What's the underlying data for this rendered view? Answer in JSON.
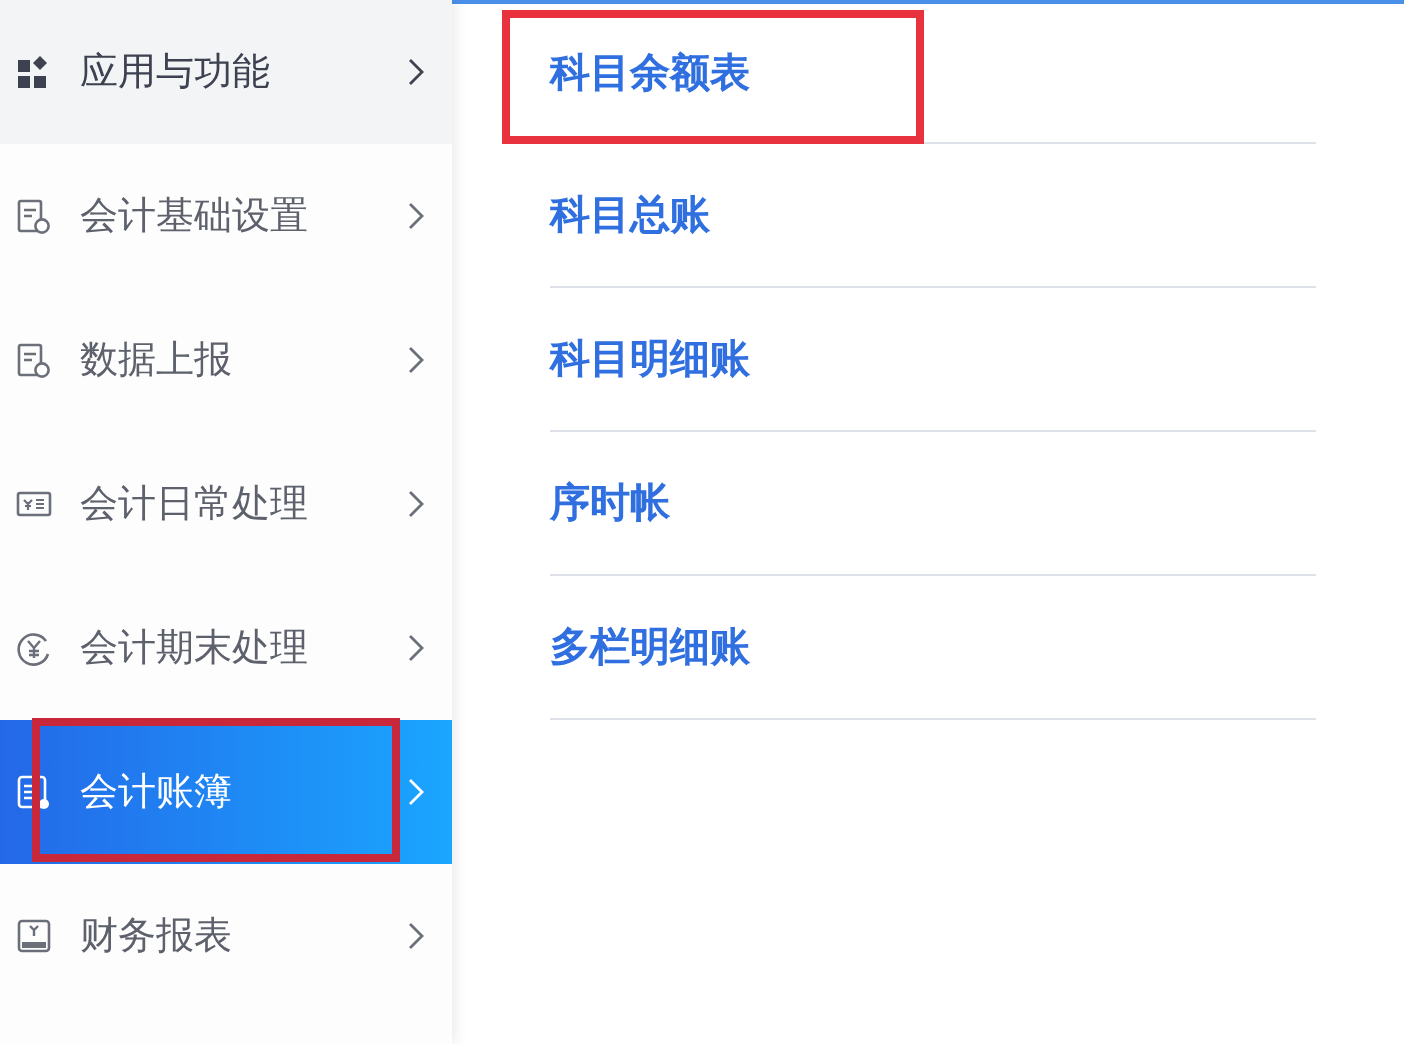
{
  "sidebar": {
    "items": [
      {
        "label": "应用与功能",
        "selected": false,
        "highlighted": true,
        "annotated": false
      },
      {
        "label": "会计基础设置",
        "selected": false,
        "highlighted": false,
        "annotated": false
      },
      {
        "label": "数据上报",
        "selected": false,
        "highlighted": false,
        "annotated": false
      },
      {
        "label": "会计日常处理",
        "selected": false,
        "highlighted": false,
        "annotated": false
      },
      {
        "label": "会计期末处理",
        "selected": false,
        "highlighted": false,
        "annotated": false
      },
      {
        "label": "会计账簿",
        "selected": true,
        "highlighted": false,
        "annotated": true
      },
      {
        "label": "财务报表",
        "selected": false,
        "highlighted": false,
        "annotated": false
      }
    ]
  },
  "submenu": {
    "items": [
      {
        "label": "科目余额表",
        "annotated": true
      },
      {
        "label": "科目总账",
        "annotated": false
      },
      {
        "label": "科目明细账",
        "annotated": false
      },
      {
        "label": "序时帐",
        "annotated": false
      },
      {
        "label": "多栏明细账",
        "annotated": false
      }
    ]
  }
}
